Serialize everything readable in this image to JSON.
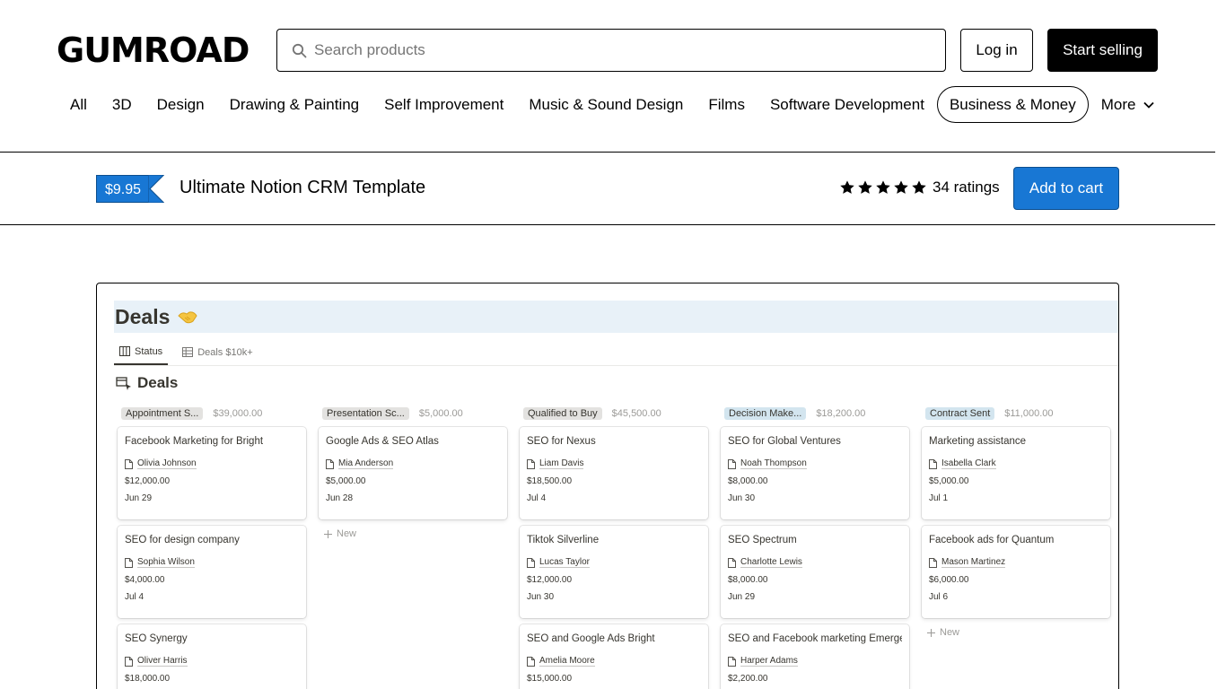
{
  "header": {
    "logo_text": "GUMROAD",
    "search_placeholder": "Search products",
    "login_label": "Log in",
    "start_selling_label": "Start selling"
  },
  "nav": {
    "items": [
      {
        "label": "All"
      },
      {
        "label": "3D"
      },
      {
        "label": "Design"
      },
      {
        "label": "Drawing & Painting"
      },
      {
        "label": "Self Improvement"
      },
      {
        "label": "Music & Sound Design"
      },
      {
        "label": "Films"
      },
      {
        "label": "Software Development"
      },
      {
        "label": "Business & Money",
        "active": true
      }
    ],
    "more_label": "More"
  },
  "product": {
    "price": "$9.95",
    "title": "Ultimate Notion CRM Template",
    "stars": 5,
    "ratings_text": "34 ratings",
    "add_to_cart_label": "Add to cart",
    "accent_color": "#1877d4"
  },
  "preview": {
    "page_title": "Deals",
    "page_icon": "handshake-icon",
    "tabs": [
      {
        "label": "Status",
        "icon": "board-icon",
        "active": true
      },
      {
        "label": "Deals $10k+",
        "icon": "table-icon",
        "active": false
      }
    ],
    "database_title": "Deals",
    "new_label": "New",
    "columns": [
      {
        "label": "Appointment S...",
        "sum": "$39,000.00",
        "color": "#e3e2e0",
        "cards": [
          {
            "title": "Facebook Marketing for Bright",
            "person": "Olivia Johnson",
            "amount": "$12,000.00",
            "date": "Jun 29"
          },
          {
            "title": "SEO for design company",
            "person": "Sophia Wilson",
            "amount": "$4,000.00",
            "date": "Jul 4"
          },
          {
            "title": "SEO Synergy",
            "person": "Oliver Harris",
            "amount": "$18,000.00",
            "date": ""
          }
        ],
        "show_new": false
      },
      {
        "label": "Presentation Sc...",
        "sum": "$5,000.00",
        "color": "#e3e2e0",
        "cards": [
          {
            "title": "Google Ads & SEO Atlas",
            "person": "Mia Anderson",
            "amount": "$5,000.00",
            "date": "Jun 28"
          }
        ],
        "show_new": true
      },
      {
        "label": "Qualified to Buy",
        "sum": "$45,500.00",
        "color": "#e3e2e0",
        "cards": [
          {
            "title": "SEO for Nexus",
            "person": "Liam Davis",
            "amount": "$18,500.00",
            "date": "Jul 4"
          },
          {
            "title": "Tiktok Silverline",
            "person": "Lucas Taylor",
            "amount": "$12,000.00",
            "date": "Jun 30"
          },
          {
            "title": "SEO and Google Ads Bright",
            "person": "Amelia Moore",
            "amount": "$15,000.00",
            "date": ""
          }
        ],
        "show_new": false
      },
      {
        "label": "Decision Make...",
        "sum": "$18,200.00",
        "color": "#d3e5ef",
        "cards": [
          {
            "title": "SEO for Global Ventures",
            "person": "Noah Thompson",
            "amount": "$8,000.00",
            "date": "Jun 30"
          },
          {
            "title": "SEO Spectrum",
            "person": "Charlotte Lewis",
            "amount": "$8,000.00",
            "date": "Jun 29"
          },
          {
            "title": "SEO and Facebook marketing Emerge",
            "person": "Harper Adams",
            "amount": "$2,200.00",
            "date": ""
          }
        ],
        "show_new": false
      },
      {
        "label": "Contract Sent",
        "sum": "$11,000.00",
        "color": "#d3e5ef",
        "cards": [
          {
            "title": "Marketing assistance",
            "person": "Isabella Clark",
            "amount": "$5,000.00",
            "date": "Jul 1"
          },
          {
            "title": "Facebook ads for Quantum",
            "person": "Mason Martinez",
            "amount": "$6,000.00",
            "date": "Jul 6"
          }
        ],
        "show_new": true
      }
    ]
  }
}
